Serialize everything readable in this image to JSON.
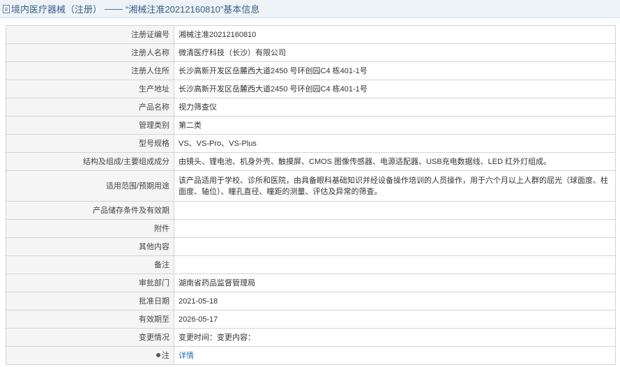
{
  "header": {
    "prefix": "境内医疗器械（注册）",
    "separator": "——",
    "title": "“湘械注准20212160810”基本信息"
  },
  "rows": [
    {
      "label": "注册证编号",
      "value": "湘械注准20212160810"
    },
    {
      "label": "注册人名称",
      "value": "微清医疗科技（长沙）有限公司"
    },
    {
      "label": "注册人住所",
      "value": "长沙高新开发区岳麓西大道2450 号环创园C4 栋401-1号"
    },
    {
      "label": "生产地址",
      "value": "长沙高新开发区岳麓西大道2450 号环创园C4 栋401-1号"
    },
    {
      "label": "产品名称",
      "value": "视力筛查仪"
    },
    {
      "label": "管理类别",
      "value": "第二类"
    },
    {
      "label": "型号规格",
      "value": "VS、VS-Pro、VS-Plus"
    },
    {
      "label": "结构及组成/主要组成成分",
      "value": "由镜头、锂电池、机身外壳、触摸屏、CMOS 图像传感器、电源适配器、USB充电数据线、LED 红外灯组成。"
    },
    {
      "label": "适用范围/预期用途",
      "value": "该产品适用于学校、诊所和医院，由具备眼科基础知识并经设备操作培训的人员操作，用于六个月以上人群的屈光（球面度、柱面度、轴位）、瞳孔直径、瞳距的测量、评估及异常的筛查。"
    },
    {
      "label": "产品储存条件及有效期",
      "value": ""
    },
    {
      "label": "附件",
      "value": ""
    },
    {
      "label": "其他内容",
      "value": ""
    },
    {
      "label": "备注",
      "value": ""
    },
    {
      "label": "审批部门",
      "value": "湖南省药品监督管理局"
    },
    {
      "label": "批准日期",
      "value": "2021-05-18"
    },
    {
      "label": "有效期至",
      "value": "2026-05-17"
    },
    {
      "label": "变更情况",
      "value": "变更时间：变更内容："
    }
  ],
  "note": {
    "label": "注",
    "link": "详情"
  }
}
